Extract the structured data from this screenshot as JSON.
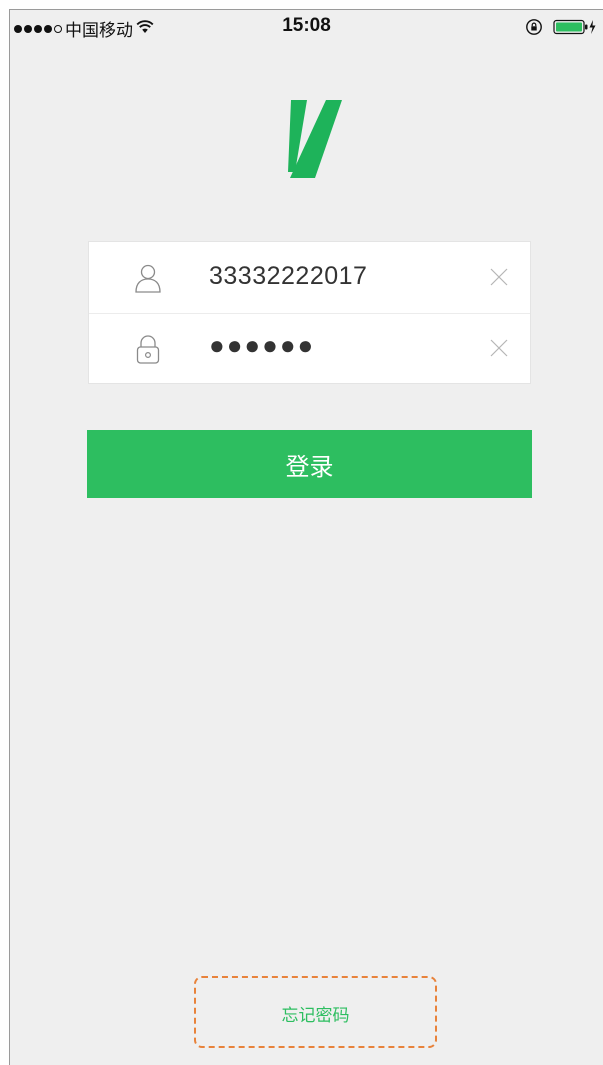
{
  "status_bar": {
    "carrier": "中国移动",
    "time": "15:08",
    "signal_dots_filled": 4,
    "signal_dots_total": 5,
    "icons": [
      "signal-icon",
      "wifi-icon",
      "orientation-lock-icon",
      "battery-icon",
      "charging-icon"
    ]
  },
  "logo": {
    "icon": "v-logo-icon",
    "color": "#1eb35a"
  },
  "login_form": {
    "account": {
      "icon": "user-icon",
      "value": "33332222017",
      "clear_icon": "clear-icon"
    },
    "password": {
      "icon": "lock-icon",
      "value": "●●●●●●",
      "clear_icon": "clear-icon"
    }
  },
  "login_button": {
    "label": "登录",
    "color": "#2dbe60"
  },
  "forgot_password": {
    "label": "忘记密码",
    "color": "#2dbe60",
    "highlight_color": "#e8823a"
  },
  "colors": {
    "background": "#efefef",
    "accent": "#2dbe60"
  }
}
